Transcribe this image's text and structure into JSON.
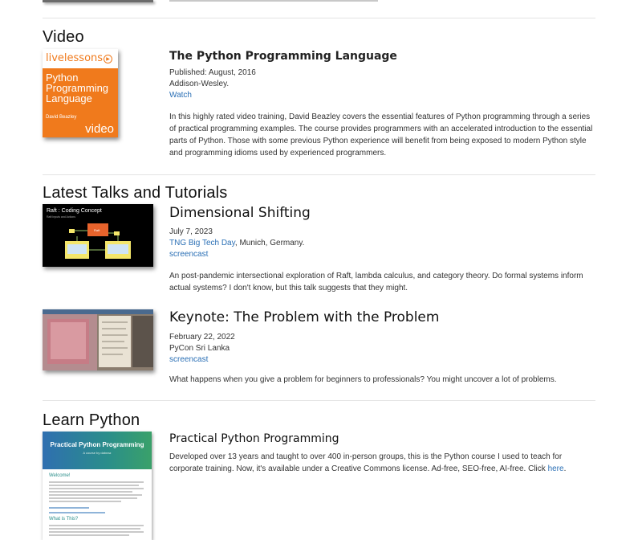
{
  "video": {
    "heading": "Video",
    "cover": {
      "brand": "livelessons",
      "title_lines": [
        "Python",
        "Programming",
        "Language"
      ],
      "author": "David Beazley",
      "word": "video"
    },
    "title": "The Python Programming Language",
    "published": "Published: August, 2016",
    "publisher": "Addison-Wesley.",
    "link": "Watch",
    "description": "In this highly rated video training, David Beazley covers the essential features of Python programming through a series of practical programming examples. The course provides programmers with an accelerated introduction to the essential parts of Python. Those with some previous Python experience will benefit from being exposed to modern Python style and programming idioms used by experienced programmers."
  },
  "talks": {
    "heading": "Latest Talks and Tutorials",
    "items": [
      {
        "title": "Dimensional Shifting",
        "date": "July 7, 2023",
        "venue_link": "TNG Big Tech Day",
        "venue_rest": ", Munich, Germany.",
        "link": "screencast",
        "description": "An post-pandemic intersectional exploration of Raft, lambda calculus, and category theory. Do formal systems inform actual systems? I don't know, but this talk suggests that they might.",
        "thumb": {
          "title": "Raft : Coding Concept",
          "sub": "Raft Inputs and Actions",
          "box": "Raft"
        }
      },
      {
        "title": "Keynote: The Problem with the Problem",
        "date": "February 22, 2022",
        "venue": "PyCon Sri Lanka",
        "link": "screencast",
        "description": "What happens when you give a problem for beginners to professionals? You might uncover a lot of problems."
      }
    ]
  },
  "learn": {
    "heading": "Learn Python",
    "cover": {
      "title": "Practical Python Programming",
      "sub": "A course by dabeaz",
      "welcome": "Welcome!",
      "what": "What is This?"
    },
    "title": "Practical Python Programming",
    "description_pre": "Developed over 13 years and taught to over 400 in-person groups, this is the Python course I used to teach for corporate training. Now, it's available under a Creative Commons license. Ad-free, SEO-free, AI-free. Click ",
    "description_link": "here",
    "description_post": "."
  },
  "colors": {
    "link": "#2a6fb5",
    "accent": "#f07a1c",
    "divider": "#e3e3e3"
  }
}
